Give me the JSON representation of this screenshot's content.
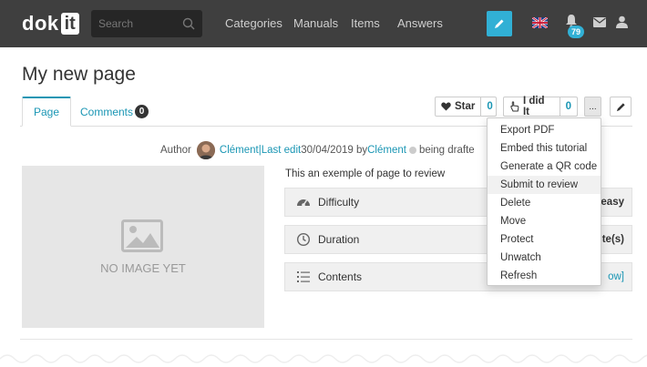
{
  "navbar": {
    "logo_text": "dok",
    "logo_box": "it",
    "search_placeholder": "Search",
    "links": [
      "Categories",
      "Manuals",
      "Items",
      "Answers"
    ],
    "notification_count": "79"
  },
  "page": {
    "title": "My new page",
    "tabs": [
      {
        "label": "Page"
      },
      {
        "label": "Comments",
        "count": "0"
      }
    ]
  },
  "actions": {
    "star_label": "Star",
    "star_count": "0",
    "idid_label": "I did It",
    "idid_count": "0",
    "more_label": "...",
    "dropdown": [
      "Export PDF",
      "Embed this tutorial",
      "Generate a QR code",
      "Submit to review",
      "Delete",
      "Move",
      "Protect",
      "Unwatch",
      "Refresh"
    ]
  },
  "author": {
    "prefix": "Author",
    "name": "Clément",
    "sep": " | ",
    "last_edit_label": "Last edit",
    "date": " 30/04/2019 by ",
    "editor": "Clément",
    "status": "being drafte"
  },
  "image": {
    "placeholder": "NO IMAGE YET"
  },
  "content": {
    "description": "This an exemple of page to review",
    "rows": [
      {
        "label": "Difficulty",
        "value": "easy"
      },
      {
        "label": "Duration",
        "value": "te(s)"
      },
      {
        "label": "Contents",
        "value": "ow]"
      }
    ]
  },
  "colors": {
    "accent": "#1a96b4",
    "navbar": "#3f3f3f",
    "edit_button": "#31b0d5"
  }
}
